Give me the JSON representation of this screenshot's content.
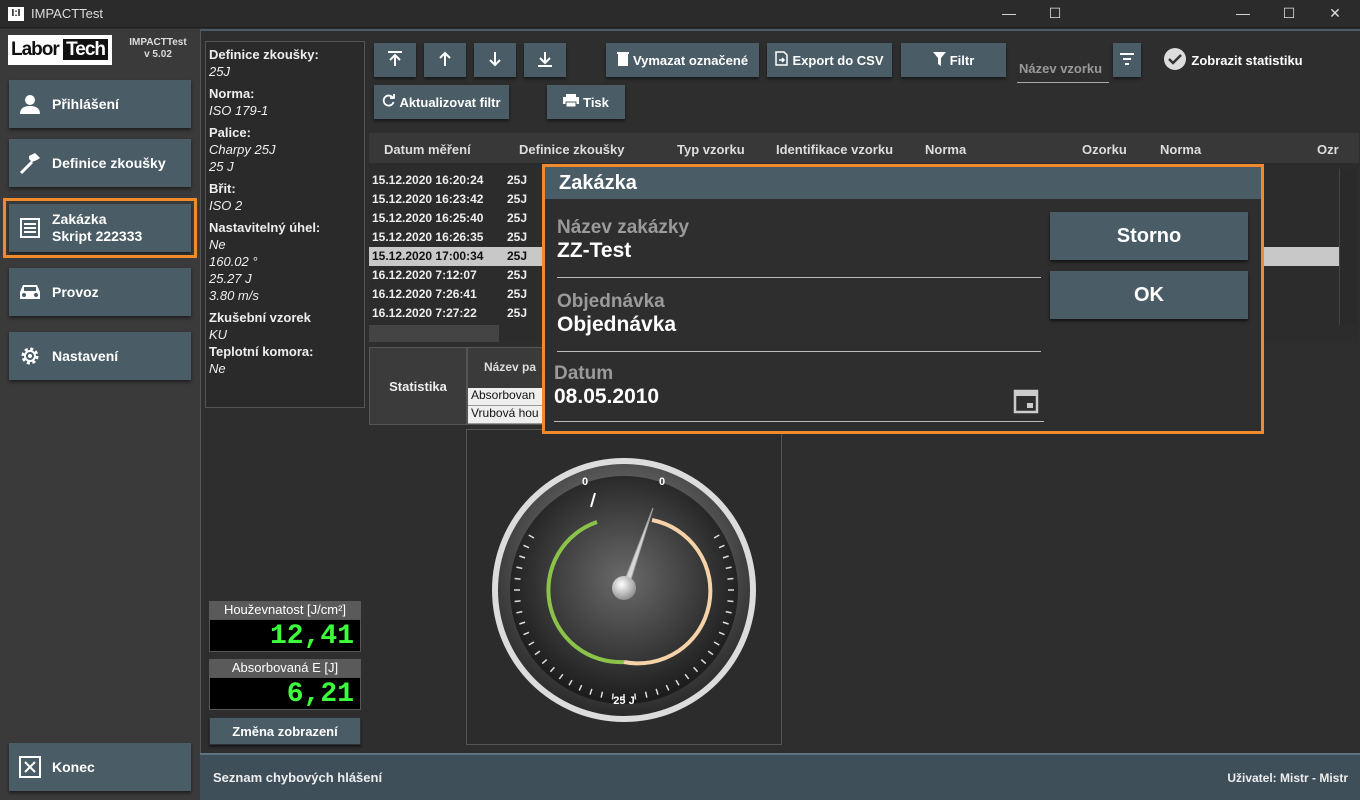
{
  "window": {
    "icon_text": "I:I",
    "title": "IMPACTTest",
    "minimize": "—",
    "maximize": "☐",
    "close": "✕"
  },
  "inner_window": {
    "minimize": "—",
    "maximize": "☐",
    "close": "✕"
  },
  "logo": {
    "labor": "Labor",
    "tech": "Tech",
    "app_name": "IMPACTTest",
    "version": "v 5.02"
  },
  "sidebar": {
    "items": [
      {
        "label": "Přihlášení",
        "icon": "user-icon"
      },
      {
        "label": "Definice zkoušky",
        "icon": "hammer-icon"
      },
      {
        "label": "Zakázka",
        "sublabel": "Skript 222333",
        "icon": "order-icon"
      },
      {
        "label": "Provoz",
        "icon": "car-icon"
      },
      {
        "label": "Nastavení",
        "icon": "gear-icon"
      }
    ],
    "exit_label": "Konec"
  },
  "info": {
    "def_label": "Definice zkoušky:",
    "def_value": "25J",
    "norma_label": "Norma:",
    "norma_value": "ISO 179-1",
    "palice_label": "Palice:",
    "palice_value1": "Charpy 25J",
    "palice_value2": "25 J",
    "brit_label": "Břit:",
    "brit_value": "ISO 2",
    "uhel_label": "Nastavitelný úhel:",
    "uhel_v1": "Ne",
    "uhel_v2": "160.02 °",
    "uhel_v3": "25.27 J",
    "uhel_v4": "3.80 m/s",
    "vzorek_label": "Zkušební vzorek",
    "vzorek_value": "KU",
    "komora_label": "Teplotní komora:",
    "komora_value": "Ne"
  },
  "toolbar": {
    "delete_label": "Vymazat označené",
    "export_label": "Export do CSV",
    "filter_label": "Filtr",
    "sample_placeholder": "Název vzorku",
    "stats_label": "Zobrazit statistiku",
    "refresh_label": "Aktualizovat filtr",
    "print_label": "Tisk"
  },
  "table": {
    "columns": [
      "Datum měření",
      "Definice zkoušky",
      "Typ vzorku",
      "Identifikace vzorku",
      "Norma",
      "Ozorku",
      "Norma",
      "Ozr"
    ],
    "rows": [
      {
        "date": "15.12.2020 16:20:24",
        "def": "25J"
      },
      {
        "date": "15.12.2020 16:23:42",
        "def": "25J"
      },
      {
        "date": "15.12.2020 16:25:40",
        "def": "25J"
      },
      {
        "date": "15.12.2020 16:26:35",
        "def": "25J"
      },
      {
        "date": "15.12.2020 17:00:34",
        "def": "25J"
      },
      {
        "date": "16.12.2020 7:12:07",
        "def": "25J"
      },
      {
        "date": "16.12.2020 7:26:41",
        "def": "25J"
      },
      {
        "date": "16.12.2020 7:27:22",
        "def": "25J"
      }
    ],
    "selected_row": 4
  },
  "stats": {
    "button_label": "Statistika",
    "header": "Název pa",
    "rows": [
      "Absorbovan",
      "Vrubová hou"
    ]
  },
  "gauge": {
    "left_mark": "0",
    "right_mark": "0",
    "unit_label": "25 J"
  },
  "readouts": {
    "toughness_label": "Houževnatost [J/cm²]",
    "toughness_value": "12,41",
    "energy_label": "Absorbovaná E [J]",
    "energy_value": "6,21",
    "change_view_label": "Změna zobrazení"
  },
  "statusbar": {
    "errors_label": "Seznam chybových hlášení",
    "user_text": "Uživatel: Mistr  -  Mistr"
  },
  "dialog": {
    "title": "Zakázka",
    "order_name_label": "Název zakázky",
    "order_name_value": "ZZ-Test",
    "order_label": "Objednávka",
    "order_value": "Objednávka",
    "date_label": "Datum",
    "date_value": "08.05.2010",
    "cancel_label": "Storno",
    "ok_label": "OK"
  },
  "colors": {
    "accent": "#4a5c66",
    "highlight": "#f08a2d",
    "readout": "#3cff3c"
  }
}
